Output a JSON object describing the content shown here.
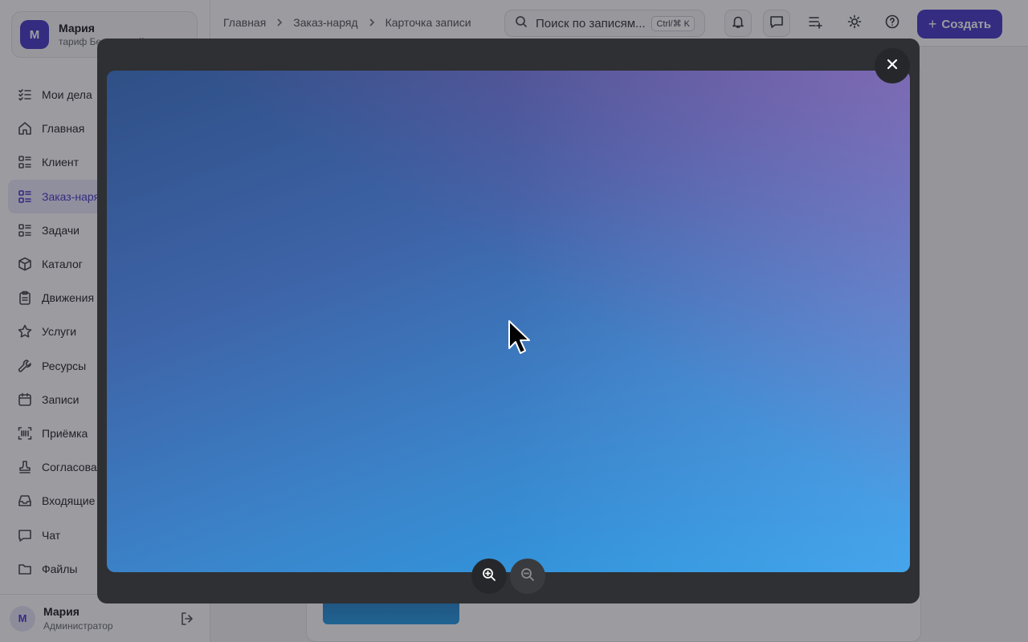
{
  "workspace": {
    "avatar_letter": "М",
    "name": "Мария",
    "plan": "тариф Бесплатный"
  },
  "sidebar": {
    "items": [
      {
        "label": "Мои дела",
        "icon": "checklist-icon"
      },
      {
        "label": "Главная",
        "icon": "home-icon"
      },
      {
        "label": "Клиент",
        "icon": "list-icon"
      },
      {
        "label": "Заказ-наряд",
        "icon": "list-icon",
        "active": true
      },
      {
        "label": "Задачи",
        "icon": "list-icon"
      },
      {
        "label": "Каталог",
        "icon": "box-icon"
      },
      {
        "label": "Движения",
        "icon": "clipboard-icon"
      },
      {
        "label": "Услуги",
        "icon": "star-icon"
      },
      {
        "label": "Ресурсы",
        "icon": "wrench-icon"
      },
      {
        "label": "Записи",
        "icon": "calendar-icon"
      },
      {
        "label": "Приёмка",
        "icon": "barcode-icon"
      },
      {
        "label": "Согласование",
        "icon": "stamp-icon"
      },
      {
        "label": "Входящие",
        "icon": "inbox-icon"
      },
      {
        "label": "Чат",
        "icon": "chat-icon"
      },
      {
        "label": "Файлы",
        "icon": "folder-icon"
      }
    ]
  },
  "user": {
    "avatar_letter": "М",
    "name": "Мария",
    "role": "Администратор"
  },
  "breadcrumb": {
    "items": [
      "Главная",
      "Заказ-наряд",
      "Карточка записи"
    ]
  },
  "search": {
    "placeholder": "Поиск по записям...",
    "shortcut": "Ctrl/⌘ K"
  },
  "toolbar": {
    "create_label": "Создать"
  },
  "colors": {
    "accent": "#4b3fc9",
    "overlay": "#2f3033"
  }
}
